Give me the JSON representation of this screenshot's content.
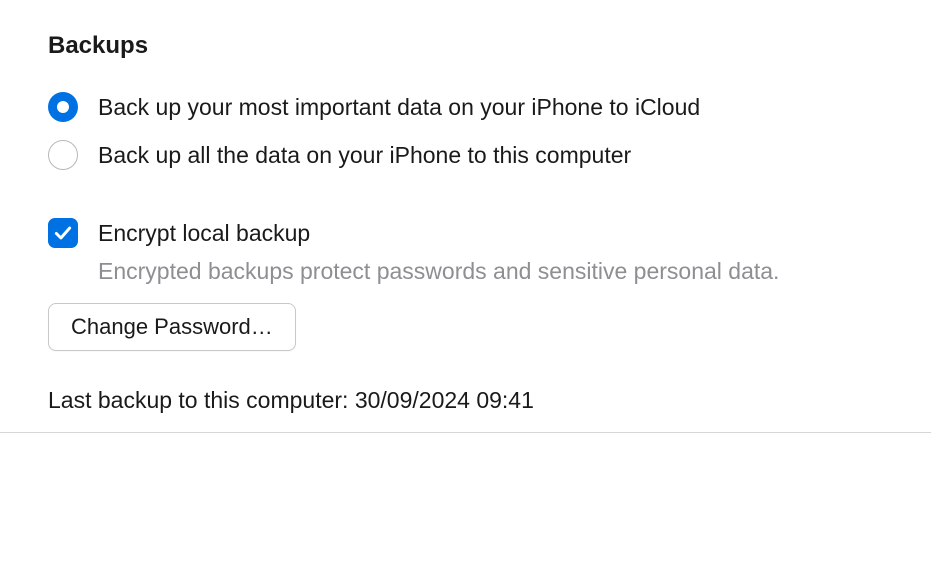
{
  "section": {
    "title": "Backups"
  },
  "radios": {
    "icloud": {
      "label": "Back up your most important data on your iPhone to iCloud",
      "selected": true
    },
    "computer": {
      "label": "Back up all the data on your iPhone to this computer",
      "selected": false
    }
  },
  "encrypt": {
    "label": "Encrypt local backup",
    "description": "Encrypted backups protect passwords and sensitive personal data.",
    "checked": true
  },
  "buttons": {
    "change_password": "Change Password…"
  },
  "status": {
    "last_backup_prefix": "Last backup to this computer: ",
    "last_backup_timestamp": "30/09/2024 09:41"
  }
}
